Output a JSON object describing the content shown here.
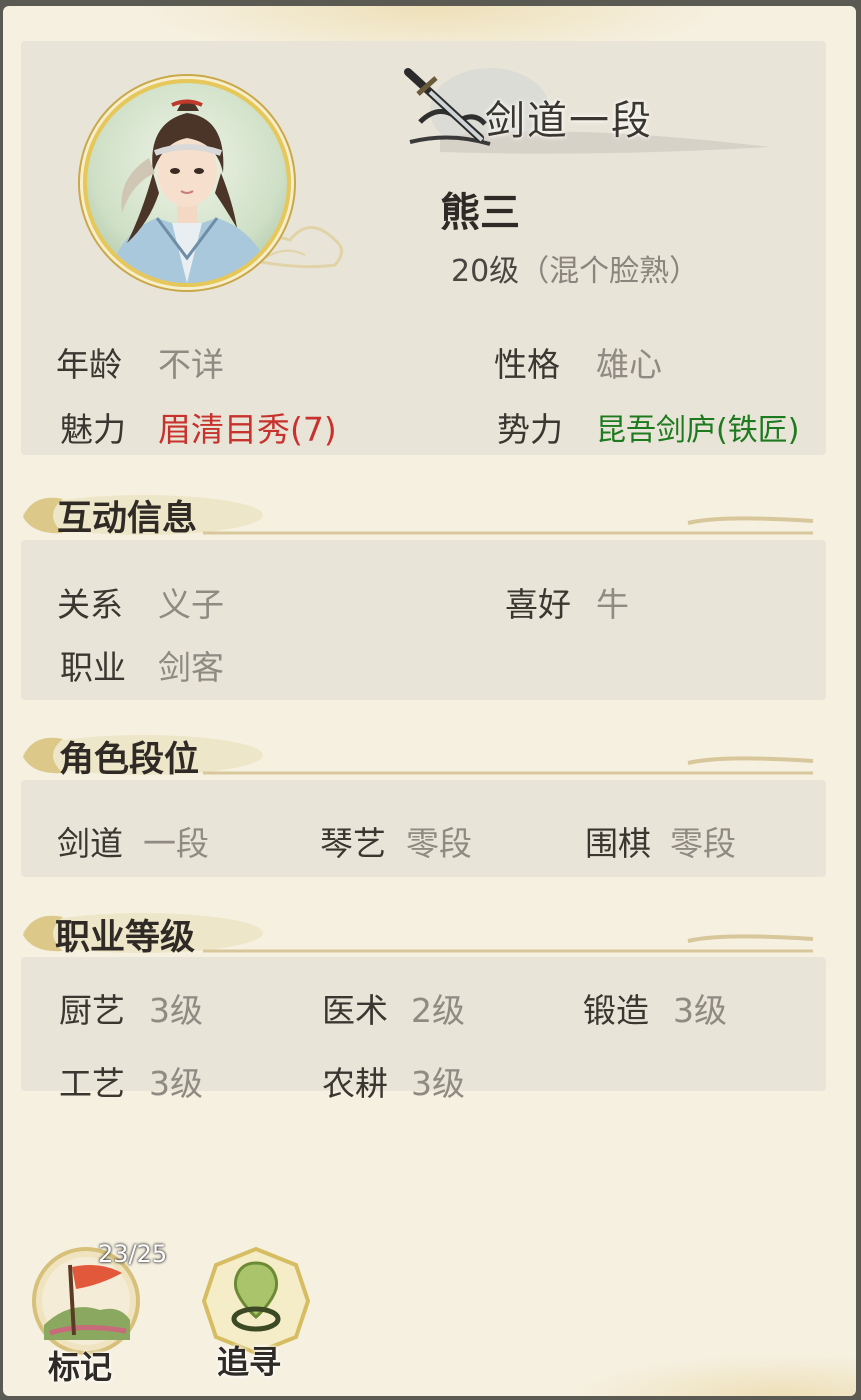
{
  "header": {
    "rank_title": "剑道一段",
    "name": "熊三",
    "level": "20级",
    "level_note": "（混个脸熟）"
  },
  "attributes": {
    "age_label": "年龄",
    "age_value": "不详",
    "personality_label": "性格",
    "personality_value": "雄心",
    "charm_label": "魅力",
    "charm_value": "眉清目秀(7)",
    "faction_label": "势力",
    "faction_value": "昆吾剑庐(铁匠)"
  },
  "sections": {
    "interaction_title": "互动信息",
    "rank_title": "角色段位",
    "job_level_title": "职业等级"
  },
  "interaction": {
    "relation_label": "关系",
    "relation_value": "义子",
    "hobby_label": "喜好",
    "hobby_value": "牛",
    "job_label": "职业",
    "job_value": "剑客"
  },
  "ranks": [
    {
      "label": "剑道",
      "value": "一段"
    },
    {
      "label": "琴艺",
      "value": "零段"
    },
    {
      "label": "围棋",
      "value": "零段"
    }
  ],
  "job_levels": [
    {
      "label": "厨艺",
      "value": "3级"
    },
    {
      "label": "医术",
      "value": "2级"
    },
    {
      "label": "锻造",
      "value": "3级"
    },
    {
      "label": "工艺",
      "value": "3级"
    },
    {
      "label": "农耕",
      "value": "3级"
    }
  ],
  "actions": {
    "mark_label": "标记",
    "mark_count": "23/25",
    "track_label": "追寻"
  },
  "colors": {
    "panel_bg": "#f6f0e1",
    "card_bg": "#e9e4d8",
    "charm_red": "#c7322c",
    "faction_green": "#1e7a1e",
    "gold": "#e6c85a"
  }
}
